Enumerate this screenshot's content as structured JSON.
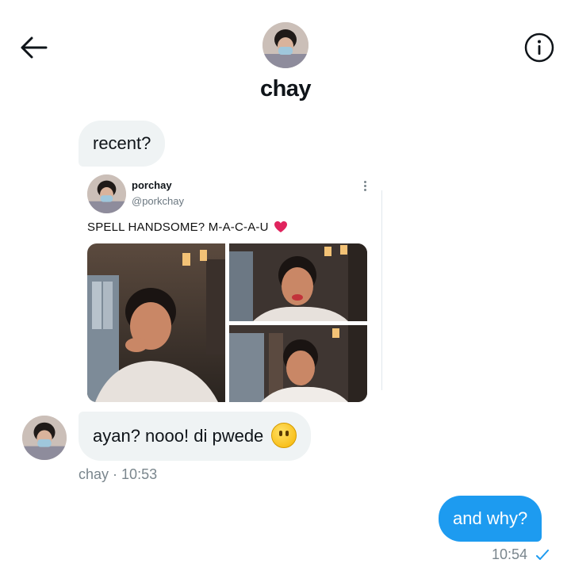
{
  "header": {
    "chat_name": "chay"
  },
  "messages": [
    {
      "direction": "in",
      "text": "recent?"
    },
    {
      "direction": "in",
      "text": "ayan? nooo! di pwede",
      "emoji": "hushed-face-emoji",
      "sender": "chay",
      "time": "· 10:53"
    },
    {
      "direction": "out",
      "text": "and why?",
      "time": "10:54",
      "status_icon": "check-icon"
    }
  ],
  "embedded_tweet": {
    "display_name": "porchay",
    "handle": "@porkchay",
    "text": "SPELL HANDSOME? M-A-C-A-U",
    "emoji": "red-heart-emoji",
    "photo_count": 3
  },
  "icons": {
    "back": "back-arrow-icon",
    "info": "info-icon",
    "more": "more-vertical-icon"
  },
  "colors": {
    "accent": "#1d9bf0",
    "incoming_bubble": "#eff3f4",
    "muted_text": "#7a868d"
  }
}
